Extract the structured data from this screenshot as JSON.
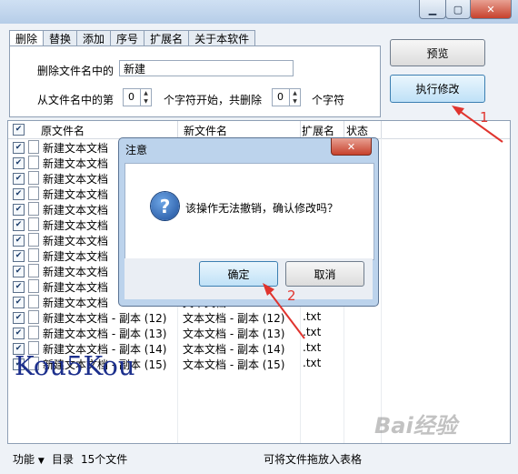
{
  "tabs": [
    "删除",
    "替换",
    "添加",
    "序号",
    "扩展名",
    "关于本软件"
  ],
  "delete_panel": {
    "contains_label": "删除文件名中的",
    "contains_value": "新建",
    "from_label": "从文件名中的第",
    "from_value": "0",
    "mid_label": "个字符开始，共删除",
    "count_value": "0",
    "end_label": "个字符"
  },
  "buttons": {
    "preview": "预览",
    "apply": "执行修改"
  },
  "list": {
    "headers": [
      "原文件名",
      "新文件名",
      "扩展名",
      "状态"
    ],
    "rows": [
      {
        "orig": "新建文本文档",
        "new": "",
        "ext": ""
      },
      {
        "orig": "新建文本文档",
        "new": "",
        "ext": ""
      },
      {
        "orig": "新建文本文档",
        "new": "",
        "ext": ""
      },
      {
        "orig": "新建文本文档",
        "new": "",
        "ext": ""
      },
      {
        "orig": "新建文本文档",
        "new": "",
        "ext": ""
      },
      {
        "orig": "新建文本文档",
        "new": "",
        "ext": ""
      },
      {
        "orig": "新建文本文档",
        "new": "",
        "ext": ""
      },
      {
        "orig": "新建文本文档",
        "new": "",
        "ext": ""
      },
      {
        "orig": "新建文本文档",
        "new": "",
        "ext": ""
      },
      {
        "orig": "新建文本文档",
        "new": "",
        "ext": ""
      },
      {
        "orig": "新建文本文档",
        "new": "文本文档",
        "ext": ".txt"
      },
      {
        "orig": "新建文本文档 - 副本 (12)",
        "new": "文本文档 - 副本 (12)",
        "ext": ".txt"
      },
      {
        "orig": "新建文本文档 - 副本 (13)",
        "new": "文本文档 - 副本 (13)",
        "ext": ".txt"
      },
      {
        "orig": "新建文本文档 - 副本 (14)",
        "new": "文本文档 - 副本 (14)",
        "ext": ".txt"
      },
      {
        "orig": "新建文本文档 - 副本 (15)",
        "new": "文本文档 - 副本 (15)",
        "ext": ".txt"
      }
    ]
  },
  "status": {
    "func": "功能",
    "dir": "目录",
    "count": "15个文件",
    "hint": "可将文件拖放入表格"
  },
  "dialog": {
    "title": "注意",
    "message": "该操作无法撤销，确认修改吗？",
    "ok": "确定",
    "cancel": "取消"
  },
  "annotations": {
    "one": "1",
    "two": "2"
  },
  "watermark": "Kou5Kou",
  "baidu": "Bai经验"
}
